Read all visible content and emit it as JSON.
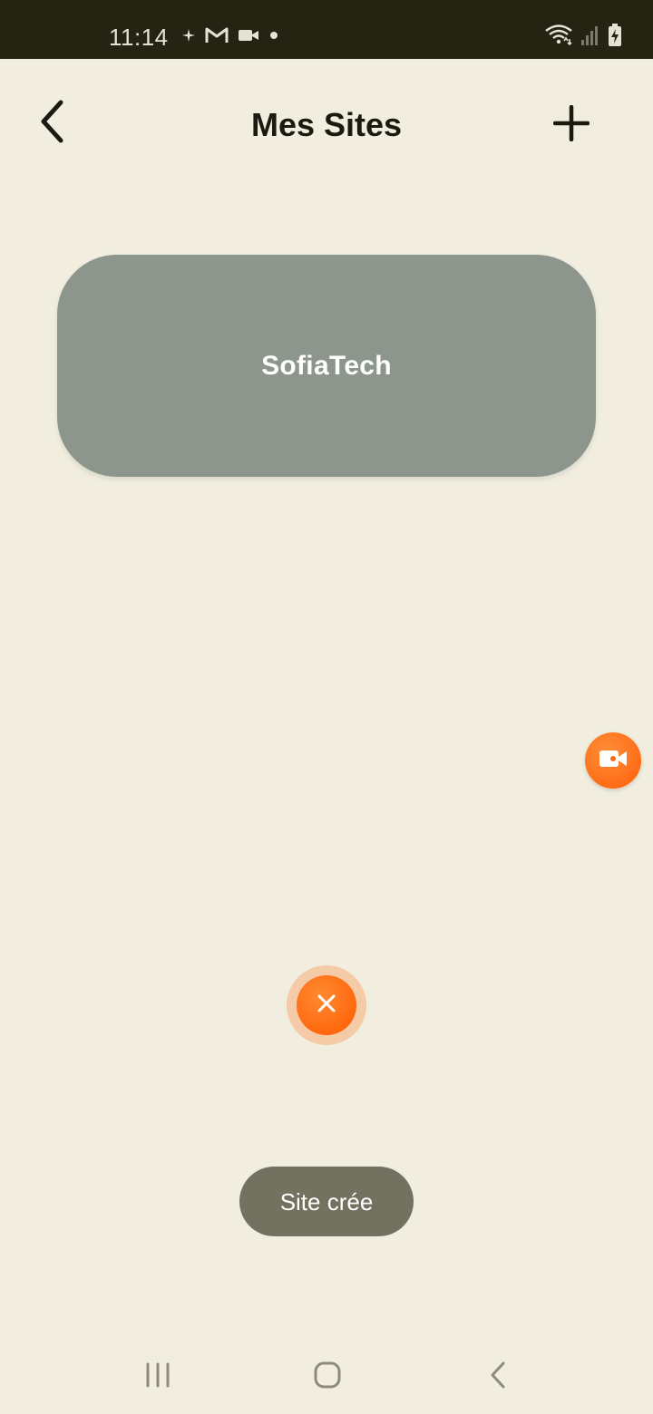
{
  "status_bar": {
    "time": "11:14",
    "left_icons": [
      "sparkle-icon",
      "gmail-icon",
      "video-camera-icon",
      "dot-icon"
    ],
    "right_icons": [
      "wifi-icon",
      "signal-icon",
      "battery-charging-icon"
    ]
  },
  "header": {
    "title": "Mes Sites",
    "back_icon": "chevron-left-icon",
    "add_icon": "plus-icon"
  },
  "sites": [
    {
      "label": "SofiaTech"
    }
  ],
  "toast": {
    "text": "Site crée"
  },
  "nav": {
    "recents_icon": "recents-icon",
    "home_icon": "home-icon",
    "back_icon": "back-icon"
  },
  "colors": {
    "background": "#F1EEDF",
    "status_bar": "#252312",
    "card": "#8D968D",
    "accent": "#FF6A10",
    "toast": "#737260",
    "title_text": "#1C1A10"
  }
}
